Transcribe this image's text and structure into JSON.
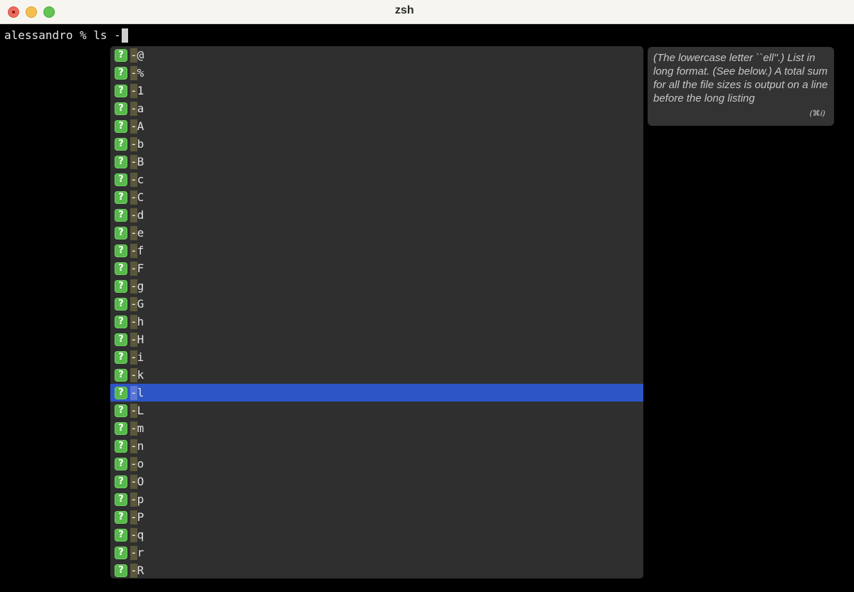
{
  "window": {
    "title": "zsh"
  },
  "terminal": {
    "prompt_text": "alessandro % ls -"
  },
  "completion": {
    "icon_glyph": "?",
    "selected_index": 19,
    "items": [
      {
        "dash": "-",
        "rest": "@"
      },
      {
        "dash": "-",
        "rest": "%"
      },
      {
        "dash": "-",
        "rest": "1"
      },
      {
        "dash": "-",
        "rest": "a"
      },
      {
        "dash": "-",
        "rest": "A"
      },
      {
        "dash": "-",
        "rest": "b"
      },
      {
        "dash": "-",
        "rest": "B"
      },
      {
        "dash": "-",
        "rest": "c"
      },
      {
        "dash": "-",
        "rest": "C"
      },
      {
        "dash": "-",
        "rest": "d"
      },
      {
        "dash": "-",
        "rest": "e"
      },
      {
        "dash": "-",
        "rest": "f"
      },
      {
        "dash": "-",
        "rest": "F"
      },
      {
        "dash": "-",
        "rest": "g"
      },
      {
        "dash": "-",
        "rest": "G"
      },
      {
        "dash": "-",
        "rest": "h"
      },
      {
        "dash": "-",
        "rest": "H"
      },
      {
        "dash": "-",
        "rest": "i"
      },
      {
        "dash": "-",
        "rest": "k"
      },
      {
        "dash": "-",
        "rest": "l"
      },
      {
        "dash": "-",
        "rest": "L"
      },
      {
        "dash": "-",
        "rest": "m"
      },
      {
        "dash": "-",
        "rest": "n"
      },
      {
        "dash": "-",
        "rest": "o"
      },
      {
        "dash": "-",
        "rest": "O"
      },
      {
        "dash": "-",
        "rest": "p"
      },
      {
        "dash": "-",
        "rest": "P"
      },
      {
        "dash": "-",
        "rest": "q"
      },
      {
        "dash": "-",
        "rest": "r"
      },
      {
        "dash": "-",
        "rest": "R"
      }
    ]
  },
  "tooltip": {
    "description": "(The lowercase letter ``ell''.) List in long format. (See below.) A total sum for all the file sizes is output on a line before the long listing",
    "shortcut": "(⌘i)"
  },
  "colors": {
    "selection": "#2d55c4",
    "icon_green": "#57b84b",
    "menu_bg": "#2f2f2f"
  }
}
